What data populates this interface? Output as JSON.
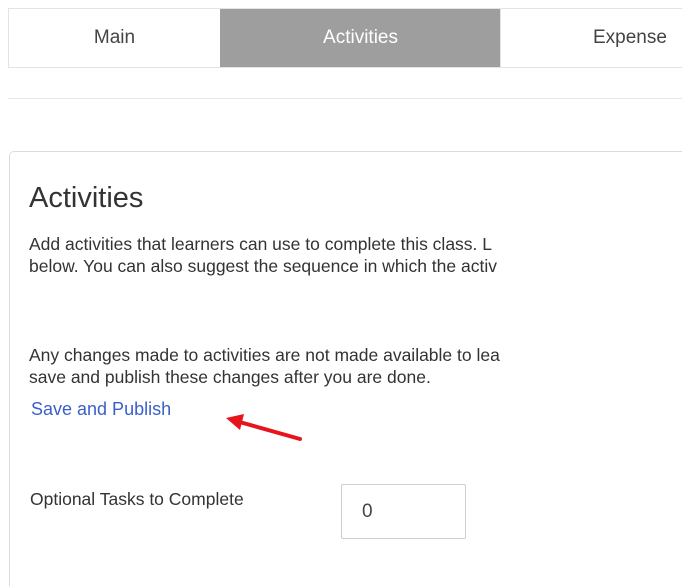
{
  "tabs": [
    {
      "label": "Main"
    },
    {
      "label": "Activities"
    },
    {
      "label": "Expense"
    }
  ],
  "activities": {
    "title": "Activities",
    "description_lines": [
      "Add activities that learners can use to complete this class. L",
      "below. You can also suggest the sequence in which the activ"
    ],
    "notice_lines": [
      "Any changes made to activities are not made available to lea",
      "save and publish these changes after you are done."
    ],
    "publish_link": "Save and Publish",
    "optional_label": "Optional Tasks to Complete",
    "optional_value": "0"
  },
  "colors": {
    "active_tab": "#9e9e9e",
    "link": "#3b5fc9",
    "annotation_arrow": "#e8141c"
  }
}
